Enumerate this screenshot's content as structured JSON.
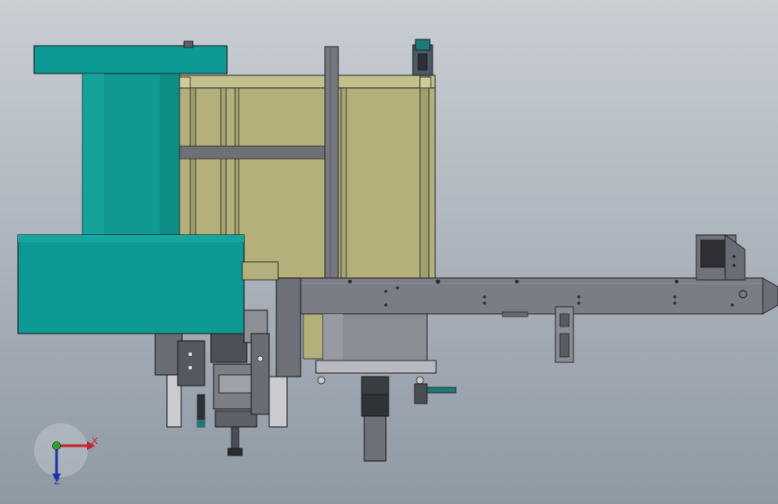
{
  "viewport": {
    "background_top": "#c9ced3",
    "background_bottom": "#8f99a4"
  },
  "colors": {
    "teal_part": "#0e9a94",
    "olive_frame": "#b3b07c",
    "steel_beam": "#7a7c86",
    "grey_parts": "#8a8d94",
    "dark_parts": "#3a3d42"
  },
  "triad": {
    "x_label": "X",
    "z_label": "Z",
    "x_color": "#c0282c",
    "z_color": "#2332a8",
    "origin_color": "#2aa52a"
  }
}
